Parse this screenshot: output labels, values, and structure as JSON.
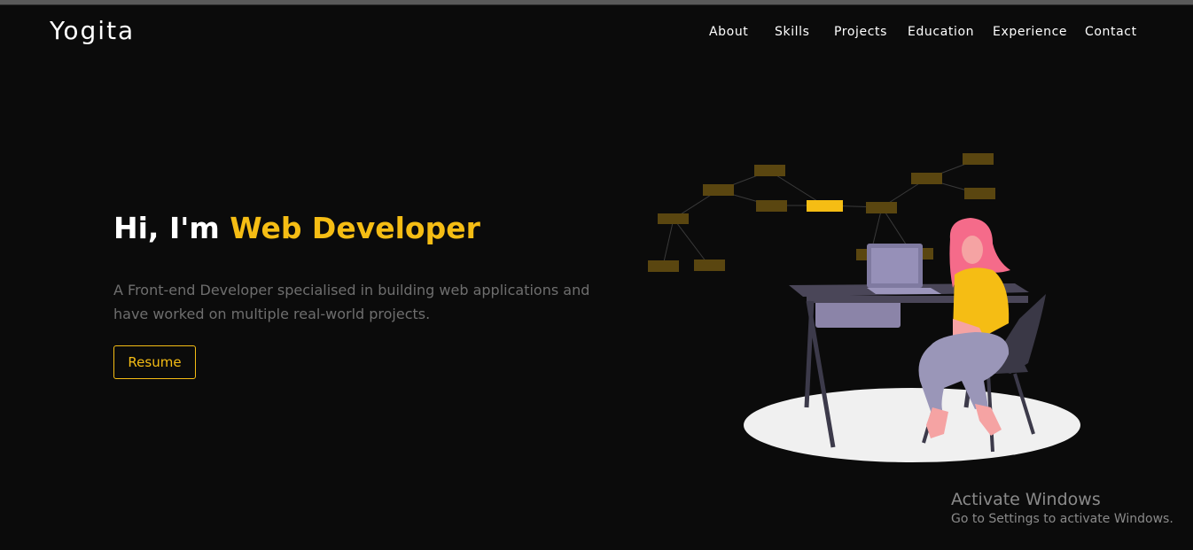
{
  "header": {
    "logo": "Yogita",
    "nav": [
      {
        "label": "About"
      },
      {
        "label": "Skills"
      },
      {
        "label": "Projects"
      },
      {
        "label": "Education"
      },
      {
        "label": "Experience"
      },
      {
        "label": "Contact"
      }
    ]
  },
  "hero": {
    "greeting": "Hi, I'm ",
    "role": "Web Developer",
    "description": "A Front-end Developer specialised in building web applications and have worked on multiple real-world projects.",
    "resume_label": "Resume"
  },
  "illustration": {
    "icon": "developer-at-desk-illustration",
    "accent_color": "#f5bd14"
  },
  "watermark": {
    "title": "Activate Windows",
    "subtitle": "Go to Settings to activate Windows."
  },
  "colors": {
    "background": "#0b0b0b",
    "accent": "#f5bd14",
    "text": "#ffffff",
    "muted": "#6e6e6e"
  }
}
